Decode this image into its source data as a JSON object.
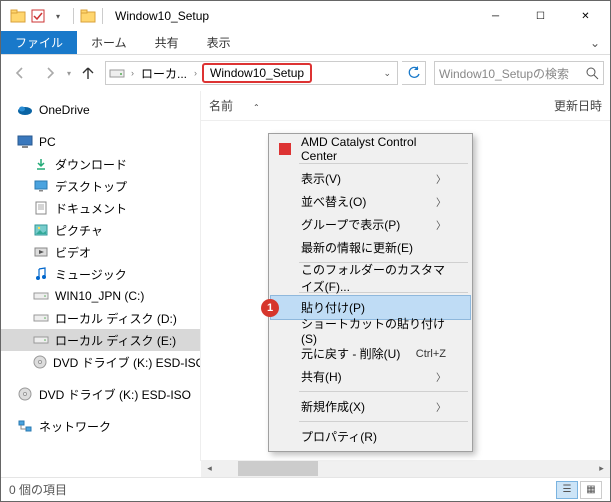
{
  "titlebar": {
    "title": "Window10_Setup"
  },
  "ribbon": {
    "file": "ファイル",
    "home": "ホーム",
    "share": "共有",
    "view": "表示"
  },
  "breadcrumb": {
    "seg1": "ローカ...",
    "current": "Window10_Setup"
  },
  "search": {
    "placeholder": "Window10_Setupの検索"
  },
  "columns": {
    "name": "名前",
    "modified": "更新日時"
  },
  "tree": {
    "onedrive": "OneDrive",
    "pc": "PC",
    "downloads": "ダウンロード",
    "desktop": "デスクトップ",
    "documents": "ドキュメント",
    "pictures": "ピクチャ",
    "videos": "ビデオ",
    "music": "ミュージック",
    "drive_c": "WIN10_JPN (C:)",
    "drive_d": "ローカル ディスク (D:)",
    "drive_e": "ローカル ディスク (E:)",
    "drive_k": "DVD ドライブ (K:) ESD-ISO",
    "drive_k2": "DVD ドライブ (K:) ESD-ISO",
    "network": "ネットワーク"
  },
  "context": {
    "amd": "AMD Catalyst Control Center",
    "view": "表示(V)",
    "sort": "並べ替え(O)",
    "group": "グループで表示(P)",
    "refresh": "最新の情報に更新(E)",
    "customize": "このフォルダーのカスタマイズ(F)...",
    "paste": "貼り付け(P)",
    "paste_shortcut": "ショートカットの貼り付け(S)",
    "undo": "元に戻す - 削除(U)",
    "undo_key": "Ctrl+Z",
    "share": "共有(H)",
    "new": "新規作成(X)",
    "properties": "プロパティ(R)",
    "badge": "1"
  },
  "status": {
    "count": "0 個の項目"
  }
}
